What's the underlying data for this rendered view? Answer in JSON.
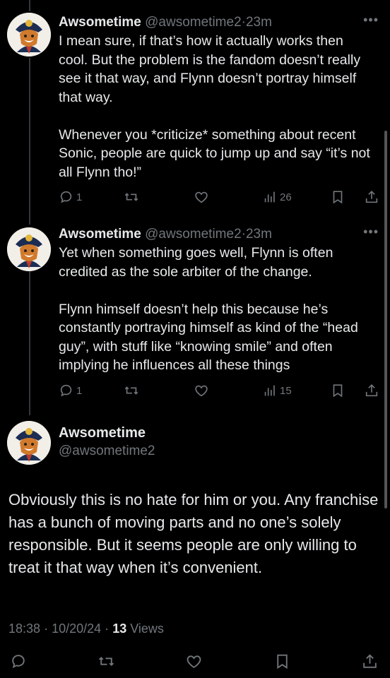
{
  "tweets": [
    {
      "name": "Awsometime",
      "handle": "@awsometime2",
      "separator": "·",
      "time": "23m",
      "text": "I mean sure, if that’s how it actually works then cool. But the problem is the fandom doesn’t really see it that way, and Flynn doesn’t portray himself that way.\n\nWhenever you *criticize* something about recent Sonic, people are quick to jump up and say “it’s not all Flynn tho!”",
      "replies": "1",
      "views": "26"
    },
    {
      "name": "Awsometime",
      "handle": "@awsometime2",
      "separator": "·",
      "time": "23m",
      "text": "Yet when something goes well, Flynn is often credited as the sole arbiter of the change.\n\nFlynn himself doesn’t help this because he’s constantly portraying himself as kind of the “head guy”, with stuff like “knowing smile” and often implying he influences all these things",
      "replies": "1",
      "views": "15"
    }
  ],
  "main": {
    "name": "Awsometime",
    "handle": "@awsometime2",
    "text": "Obviously this is no hate for him or you. Any franchise has a bunch of moving parts and no one’s solely responsible. But it seems people are only willing to treat it that way when it’s convenient.",
    "time": "18:38",
    "date": "10/20/24",
    "separator": "·",
    "views_count": "13",
    "views_label": "Views"
  },
  "more_glyph": "•••",
  "icons": {
    "reply": "reply-icon",
    "retweet": "retweet-icon",
    "like": "heart-icon",
    "views": "views-icon",
    "bookmark": "bookmark-icon",
    "share": "share-icon"
  },
  "colors": {
    "background": "#000000",
    "text": "#e7e9ea",
    "muted": "#71767b",
    "thread_line": "#333639"
  }
}
